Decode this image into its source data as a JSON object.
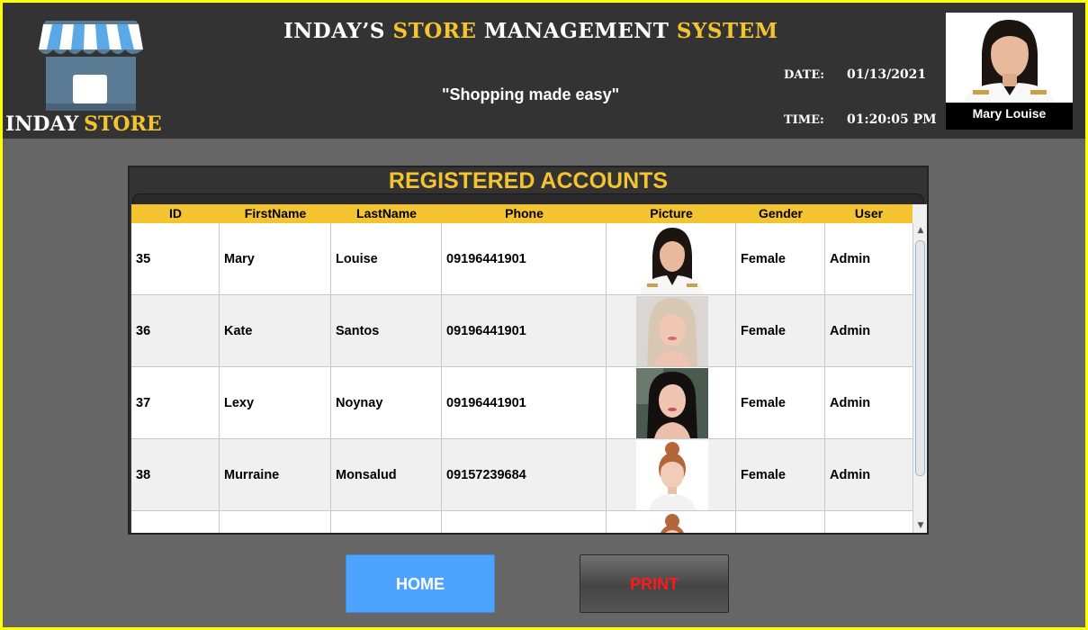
{
  "header": {
    "logo": {
      "word1": "INDAY",
      "word2": "STORE"
    },
    "title_parts": [
      {
        "text": "INDAY’S ",
        "accent": false
      },
      {
        "text": "STORE ",
        "accent": true
      },
      {
        "text": "MANAGEMENT ",
        "accent": false
      },
      {
        "text": "SYSTEM",
        "accent": true
      }
    ],
    "tagline": "\"Shopping made easy\"",
    "date_label": "DATE:",
    "date_value": "01/13/2021",
    "time_label": "TIME:",
    "time_value": "01:20:05 PM",
    "user_name": "Mary Louise"
  },
  "panel": {
    "title": "REGISTERED ACCOUNTS",
    "columns": [
      "ID",
      "FirstName",
      "LastName",
      "Phone",
      "Picture",
      "Gender",
      "User"
    ],
    "rows": [
      {
        "id": "35",
        "first": "Mary",
        "last": "Louise",
        "phone": "09196441901",
        "picture": "photo-dark-hair-uniform",
        "gender": "Female",
        "user": "Admin"
      },
      {
        "id": "36",
        "first": "Kate",
        "last": "Santos",
        "phone": "09196441901",
        "picture": "photo-blonde-hair",
        "gender": "Female",
        "user": "Admin"
      },
      {
        "id": "37",
        "first": "Lexy",
        "last": "Noynay",
        "phone": "09196441901",
        "picture": "photo-dark-hair",
        "gender": "Female",
        "user": "Admin"
      },
      {
        "id": "38",
        "first": "Murraine",
        "last": "Monsalud",
        "phone": "09157239684",
        "picture": "photo-red-hair-bun",
        "gender": "Female",
        "user": "Admin"
      },
      {
        "id": "",
        "first": "",
        "last": "",
        "phone": "",
        "picture": "photo-red-hair-bun",
        "gender": "",
        "user": ""
      }
    ]
  },
  "buttons": {
    "home": "HOME",
    "print": "PRINT"
  },
  "colors": {
    "accent": "#f4c430",
    "frame": "#ffff00",
    "home_button": "#4da3ff",
    "print_text": "#ff1a1a"
  }
}
